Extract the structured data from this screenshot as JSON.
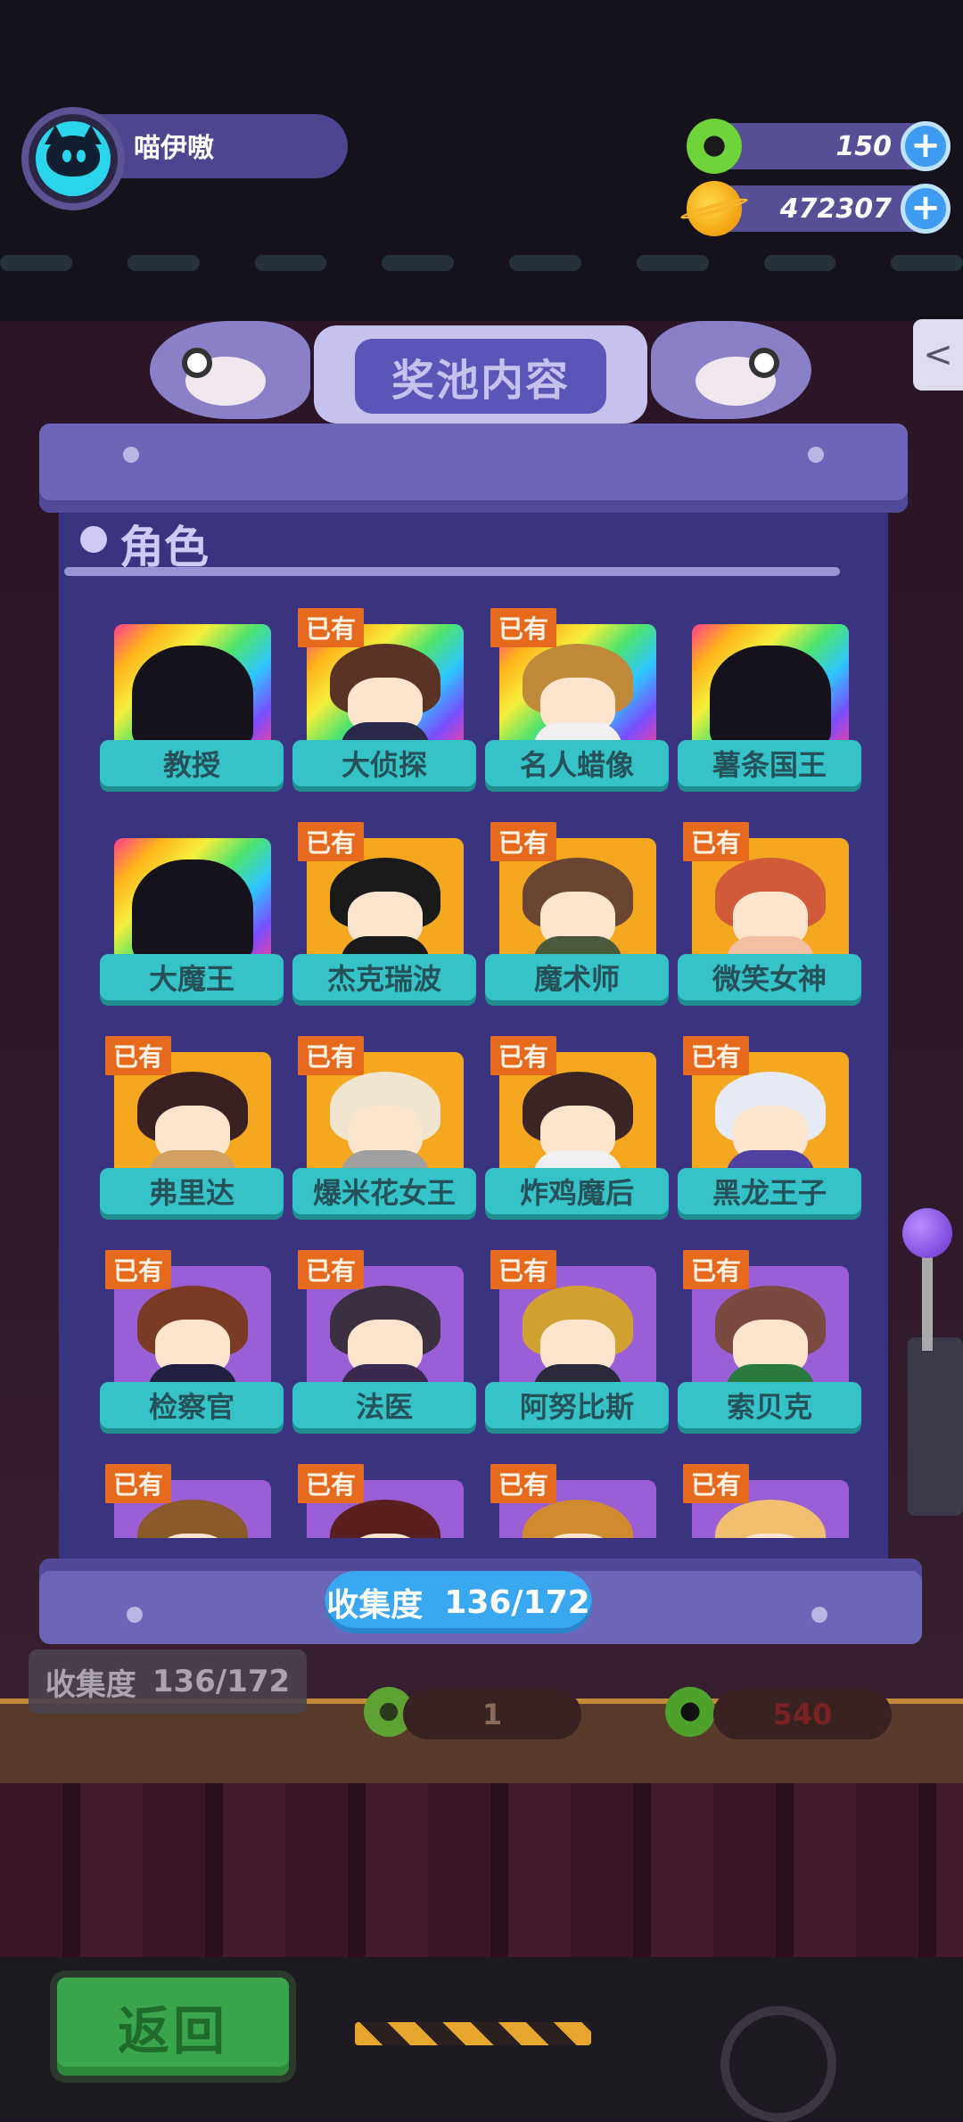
{
  "header": {
    "username": "喵伊嗷",
    "currency": [
      {
        "icon": "green-donut-icon",
        "value": "150"
      },
      {
        "icon": "gold-planet-icon",
        "value": "472307"
      }
    ]
  },
  "modal": {
    "title": "奖池内容",
    "section": "角色",
    "owned_tag": "已有",
    "characters": [
      {
        "name": "教授",
        "owned": false,
        "frame": "rainbow"
      },
      {
        "name": "大侦探",
        "owned": true,
        "frame": "rainbow"
      },
      {
        "name": "名人蜡像",
        "owned": true,
        "frame": "rainbow"
      },
      {
        "name": "薯条国王",
        "owned": false,
        "frame": "rainbow"
      },
      {
        "name": "大魔王",
        "owned": false,
        "frame": "rainbow"
      },
      {
        "name": "杰克瑞波",
        "owned": true,
        "frame": "gold"
      },
      {
        "name": "魔术师",
        "owned": true,
        "frame": "gold"
      },
      {
        "name": "微笑女神",
        "owned": true,
        "frame": "gold"
      },
      {
        "name": "弗里达",
        "owned": true,
        "frame": "gold"
      },
      {
        "name": "爆米花女王",
        "owned": true,
        "frame": "gold"
      },
      {
        "name": "炸鸡魔后",
        "owned": true,
        "frame": "gold"
      },
      {
        "name": "黑龙王子",
        "owned": true,
        "frame": "gold"
      },
      {
        "name": "检察官",
        "owned": true,
        "frame": "purple"
      },
      {
        "name": "法医",
        "owned": true,
        "frame": "purple"
      },
      {
        "name": "阿努比斯",
        "owned": true,
        "frame": "purple"
      },
      {
        "name": "索贝克",
        "owned": true,
        "frame": "purple"
      },
      {
        "name": "",
        "owned": true,
        "frame": "purple"
      },
      {
        "name": "",
        "owned": true,
        "frame": "purple"
      },
      {
        "name": "",
        "owned": true,
        "frame": "purple"
      },
      {
        "name": "",
        "owned": true,
        "frame": "purple"
      }
    ],
    "progress_label": "收集度",
    "progress_value": "136/172"
  },
  "background": {
    "collection_label": "收集度",
    "collection_value": "136/172",
    "pill_left_value": "1",
    "pill_right_value": "540"
  },
  "footer": {
    "back_label": "返回"
  }
}
